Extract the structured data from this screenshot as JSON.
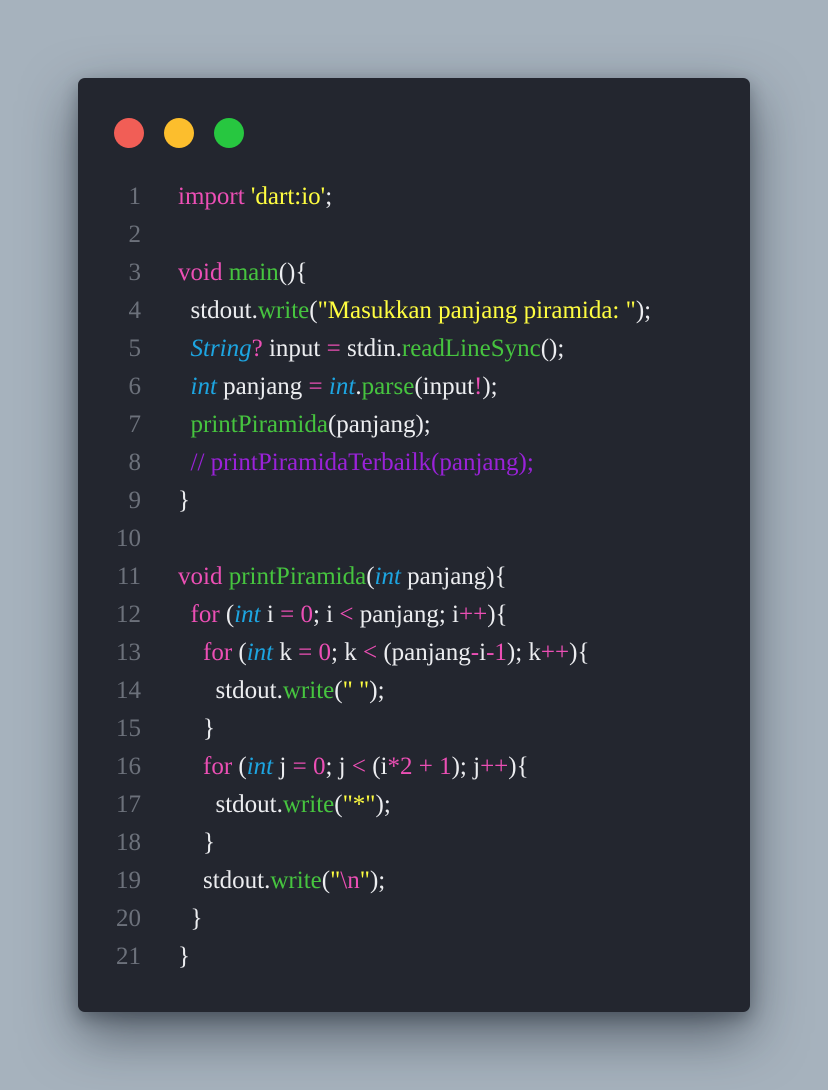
{
  "theme": {
    "background": "#a6b2bd",
    "window": "#23262f",
    "line_number": "#6c717b",
    "text": "#ecedf0",
    "keyword": "#ec4fb5",
    "function": "#46c43f",
    "string": "#fffd40",
    "type": "#1da5e1",
    "comment": "#9a22d9"
  },
  "window_controls": [
    {
      "name": "close-dot",
      "color": "#f15e56"
    },
    {
      "name": "minimize-dot",
      "color": "#fcbe2d"
    },
    {
      "name": "maximize-dot",
      "color": "#27c740"
    }
  ],
  "code": {
    "language": "dart",
    "lines": [
      {
        "n": "1",
        "tokens": [
          [
            "kw",
            "import"
          ],
          [
            "tx",
            " "
          ],
          [
            "str",
            "'dart:io'"
          ],
          [
            "tx",
            ";"
          ]
        ]
      },
      {
        "n": "2",
        "tokens": []
      },
      {
        "n": "3",
        "tokens": [
          [
            "kw",
            "void"
          ],
          [
            "tx",
            " "
          ],
          [
            "fn",
            "main"
          ],
          [
            "tx",
            "(){"
          ]
        ]
      },
      {
        "n": "4",
        "tokens": [
          [
            "tx",
            "  stdout."
          ],
          [
            "fn",
            "write"
          ],
          [
            "tx",
            "("
          ],
          [
            "str",
            "\"Masukkan panjang piramida: \""
          ],
          [
            "tx",
            ");"
          ]
        ]
      },
      {
        "n": "5",
        "tokens": [
          [
            "tx",
            "  "
          ],
          [
            "ty",
            "String"
          ],
          [
            "op",
            "?"
          ],
          [
            "tx",
            " input "
          ],
          [
            "op",
            "="
          ],
          [
            "tx",
            " stdin."
          ],
          [
            "fn",
            "readLineSync"
          ],
          [
            "tx",
            "();"
          ]
        ]
      },
      {
        "n": "6",
        "tokens": [
          [
            "tx",
            "  "
          ],
          [
            "ty",
            "int"
          ],
          [
            "tx",
            " panjang "
          ],
          [
            "op",
            "="
          ],
          [
            "tx",
            " "
          ],
          [
            "ty",
            "int"
          ],
          [
            "tx",
            "."
          ],
          [
            "fn",
            "parse"
          ],
          [
            "tx",
            "(input"
          ],
          [
            "op",
            "!"
          ],
          [
            "tx",
            ");"
          ]
        ]
      },
      {
        "n": "7",
        "tokens": [
          [
            "tx",
            "  "
          ],
          [
            "fn",
            "printPiramida"
          ],
          [
            "tx",
            "(panjang);"
          ]
        ]
      },
      {
        "n": "8",
        "tokens": [
          [
            "tx",
            "  "
          ],
          [
            "cm",
            "// printPiramidaTerbailk(panjang);"
          ]
        ]
      },
      {
        "n": "9",
        "tokens": [
          [
            "tx",
            "}"
          ]
        ]
      },
      {
        "n": "10",
        "tokens": []
      },
      {
        "n": "11",
        "tokens": [
          [
            "kw",
            "void"
          ],
          [
            "tx",
            " "
          ],
          [
            "fn",
            "printPiramida"
          ],
          [
            "tx",
            "("
          ],
          [
            "ty",
            "int"
          ],
          [
            "tx",
            " panjang){"
          ]
        ]
      },
      {
        "n": "12",
        "tokens": [
          [
            "tx",
            "  "
          ],
          [
            "kw",
            "for"
          ],
          [
            "tx",
            " ("
          ],
          [
            "ty",
            "int"
          ],
          [
            "tx",
            " i "
          ],
          [
            "op",
            "="
          ],
          [
            "tx",
            " "
          ],
          [
            "num",
            "0"
          ],
          [
            "tx",
            "; i "
          ],
          [
            "op",
            "<"
          ],
          [
            "tx",
            " panjang; i"
          ],
          [
            "op",
            "++"
          ],
          [
            "tx",
            "){"
          ]
        ]
      },
      {
        "n": "13",
        "tokens": [
          [
            "tx",
            "    "
          ],
          [
            "kw",
            "for"
          ],
          [
            "tx",
            " ("
          ],
          [
            "ty",
            "int"
          ],
          [
            "tx",
            " k "
          ],
          [
            "op",
            "="
          ],
          [
            "tx",
            " "
          ],
          [
            "num",
            "0"
          ],
          [
            "tx",
            "; k "
          ],
          [
            "op",
            "<"
          ],
          [
            "tx",
            " (panjang"
          ],
          [
            "op",
            "-"
          ],
          [
            "tx",
            "i"
          ],
          [
            "op",
            "-"
          ],
          [
            "num",
            "1"
          ],
          [
            "tx",
            "); k"
          ],
          [
            "op",
            "++"
          ],
          [
            "tx",
            "){"
          ]
        ]
      },
      {
        "n": "14",
        "tokens": [
          [
            "tx",
            "      stdout."
          ],
          [
            "fn",
            "write"
          ],
          [
            "tx",
            "("
          ],
          [
            "str",
            "\" \""
          ],
          [
            "tx",
            ");"
          ]
        ]
      },
      {
        "n": "15",
        "tokens": [
          [
            "tx",
            "    }"
          ]
        ]
      },
      {
        "n": "16",
        "tokens": [
          [
            "tx",
            "    "
          ],
          [
            "kw",
            "for"
          ],
          [
            "tx",
            " ("
          ],
          [
            "ty",
            "int"
          ],
          [
            "tx",
            " j "
          ],
          [
            "op",
            "="
          ],
          [
            "tx",
            " "
          ],
          [
            "num",
            "0"
          ],
          [
            "tx",
            "; j "
          ],
          [
            "op",
            "<"
          ],
          [
            "tx",
            " (i"
          ],
          [
            "op",
            "*"
          ],
          [
            "num",
            "2"
          ],
          [
            "tx",
            " "
          ],
          [
            "op",
            "+"
          ],
          [
            "tx",
            " "
          ],
          [
            "num",
            "1"
          ],
          [
            "tx",
            "); j"
          ],
          [
            "op",
            "++"
          ],
          [
            "tx",
            "){"
          ]
        ]
      },
      {
        "n": "17",
        "tokens": [
          [
            "tx",
            "      stdout."
          ],
          [
            "fn",
            "write"
          ],
          [
            "tx",
            "("
          ],
          [
            "str",
            "\"*\""
          ],
          [
            "tx",
            ");"
          ]
        ]
      },
      {
        "n": "18",
        "tokens": [
          [
            "tx",
            "    }"
          ]
        ]
      },
      {
        "n": "19",
        "tokens": [
          [
            "tx",
            "    stdout."
          ],
          [
            "fn",
            "write"
          ],
          [
            "tx",
            "("
          ],
          [
            "str",
            "\""
          ],
          [
            "esc",
            "\\n"
          ],
          [
            "str",
            "\""
          ],
          [
            "tx",
            ");"
          ]
        ]
      },
      {
        "n": "20",
        "tokens": [
          [
            "tx",
            "  }"
          ]
        ]
      },
      {
        "n": "21",
        "tokens": [
          [
            "tx",
            "}"
          ]
        ]
      }
    ]
  }
}
